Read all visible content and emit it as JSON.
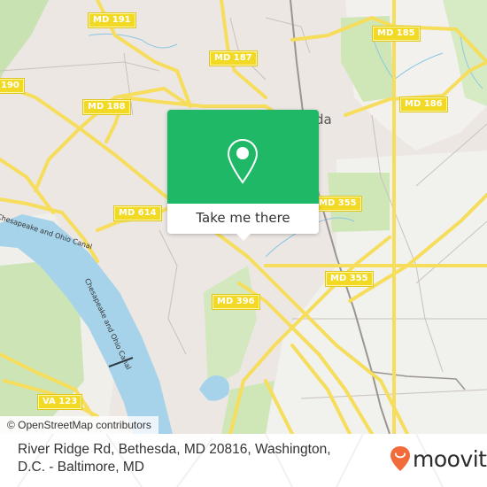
{
  "map": {
    "place_label": "da",
    "road_shields": [
      {
        "id": "md191",
        "label": "MD 191"
      },
      {
        "id": "md187",
        "label": "MD 187"
      },
      {
        "id": "md185",
        "label": "MD 185"
      },
      {
        "id": "md190",
        "label": "190"
      },
      {
        "id": "md188",
        "label": "MD 188"
      },
      {
        "id": "md186",
        "label": "MD 186"
      },
      {
        "id": "md614",
        "label": "MD 614"
      },
      {
        "id": "md355a",
        "label": "MD 355"
      },
      {
        "id": "md355b",
        "label": "MD 355"
      },
      {
        "id": "md396",
        "label": "MD 396"
      },
      {
        "id": "va123",
        "label": "VA 123"
      }
    ],
    "canal_label": "Chesapeake and Ohio Canal",
    "canal_label_top": "Chesapeake and Ohio Canal",
    "attribution": "© OpenStreetMap contributors"
  },
  "popup": {
    "button_label": "Take me there",
    "icon": "map-pin-icon",
    "color": "#1fb866"
  },
  "footer": {
    "address": "River Ridge Rd, Bethesda, MD 20816, Washington, D.C. - Baltimore, MD",
    "brand": "moovit",
    "brand_color": "#f26b3a"
  }
}
